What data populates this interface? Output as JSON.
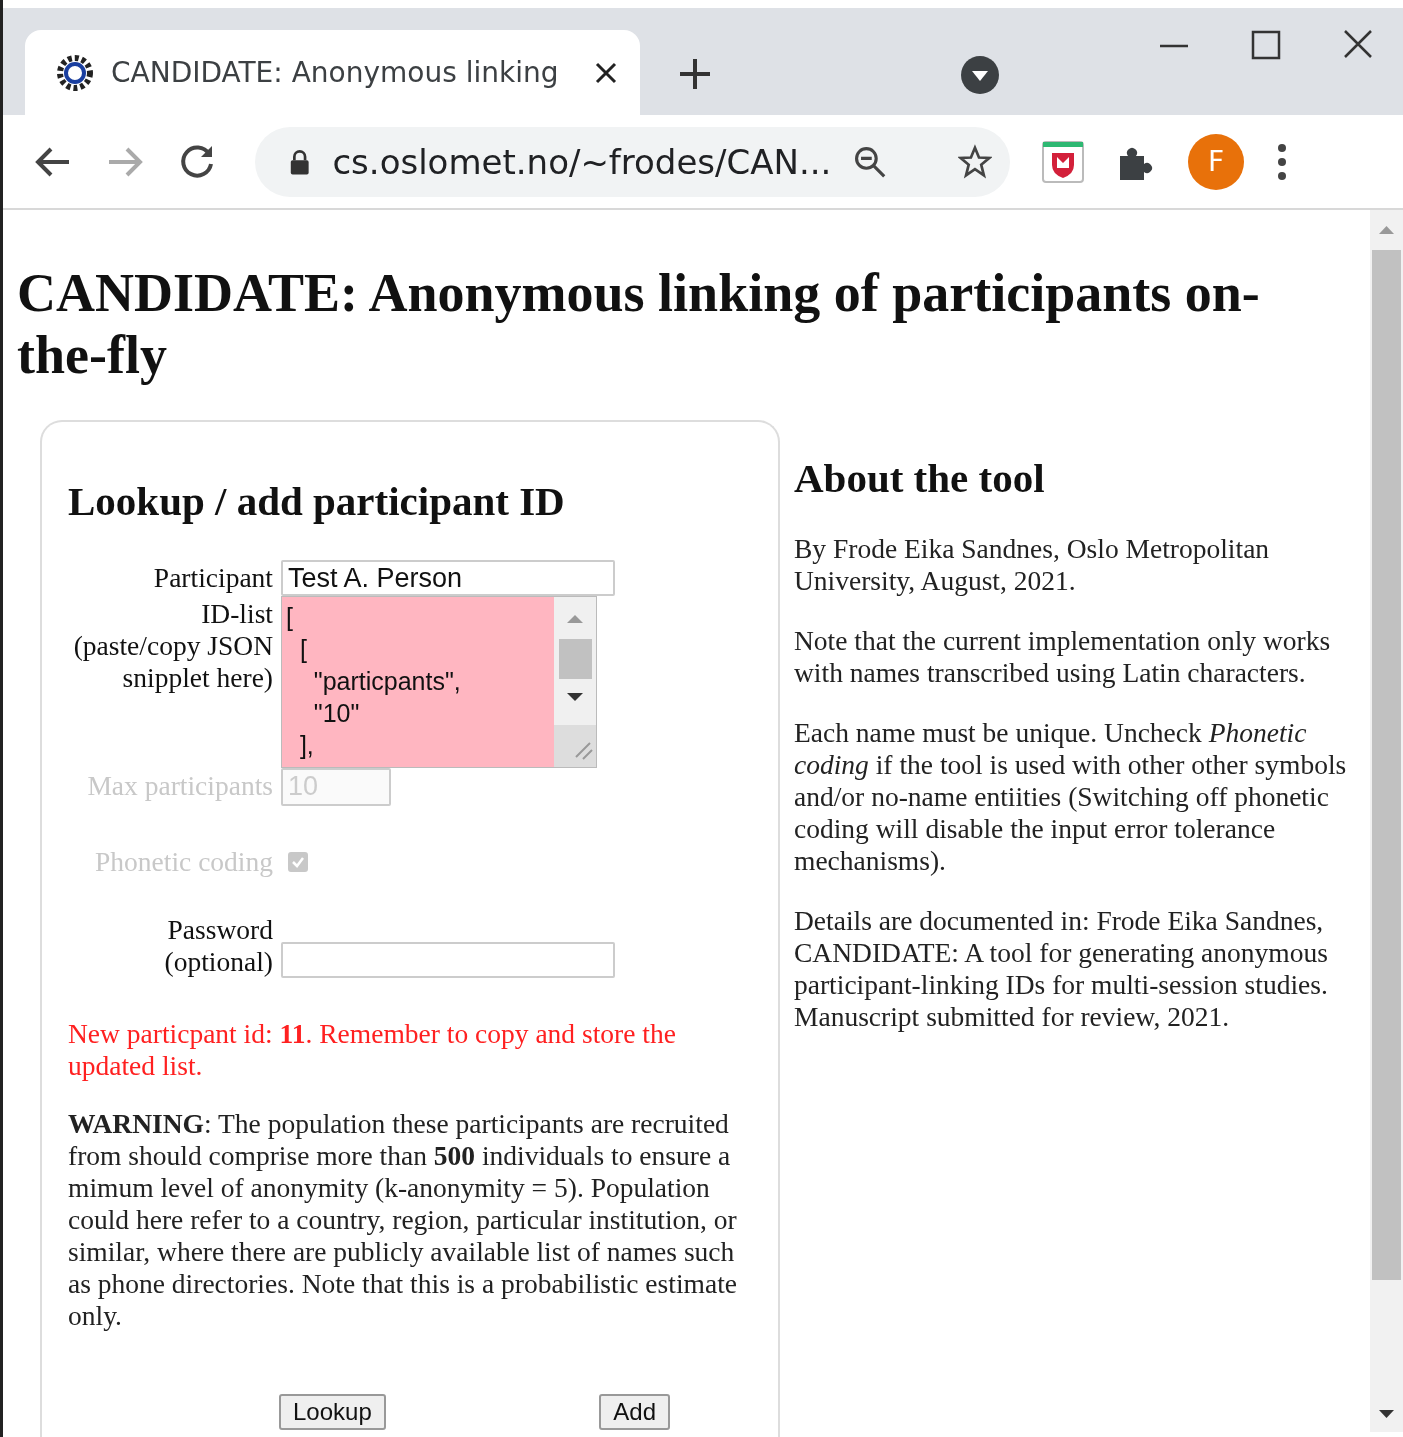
{
  "browser": {
    "tab": {
      "title": "CANDIDATE: Anonymous linking",
      "selected": true
    },
    "toolbar": {
      "forward_disabled": true,
      "url": "cs.oslomet.no/~frodes/CAN...",
      "avatar": "F"
    }
  },
  "page": {
    "title": "CANDIDATE: Anonymous linking of participants on-the-fly",
    "form": {
      "heading": "Lookup / add participant ID",
      "fields": [
        {
          "kind": "text",
          "label": "Participant",
          "value": "Test A. Person",
          "disabled": false
        },
        {
          "kind": "textarea",
          "label": "ID-list (paste/copy JSON snipplet here)",
          "value": "[\n  [\n    \"particpants\",\n    \"10\"\n  ],",
          "invalid": true,
          "disabled": false
        },
        {
          "kind": "number",
          "label": "Max participants",
          "value": "10",
          "disabled": true
        },
        {
          "kind": "checkbox",
          "label": "Phonetic coding",
          "checked": true,
          "disabled": true
        },
        {
          "kind": "password",
          "label": "Password (optional)",
          "disabled": false
        }
      ],
      "message": "New particpant id: **11**. Remember to copy and store the updated list.",
      "warning": "**WARNING**: The population these participants are recruited from should comprise more than **500** individuals to ensure a mimum level of anonymity (k-anonymity = 5). Population could here refer to a country, region, particular institution, or similar, where there are publicly available list of names such as phone directories. Note that this is a probabilistic estimate only.",
      "buttons": [
        "Lookup",
        "Add"
      ]
    },
    "about": {
      "heading": "About the tool",
      "paragraphs": [
        "By Frode Eika Sandnes, Oslo Metropolitan University, August, 2021.",
        "Note that the current implementation only works with names transcribed using Latin characters.",
        "Each name must be unique. Uncheck *Phonetic coding* if the tool is used with other other symbols and/or no-name entiities (Switching off phonetic coding will disable the input error tolerance mechanisms).",
        "Details are documented in: Frode Eika Sandnes, CANDIDATE: A tool for generating anonymous participant-linking IDs for multi-session studies. Manuscript submitted for review, 2021."
      ]
    }
  }
}
